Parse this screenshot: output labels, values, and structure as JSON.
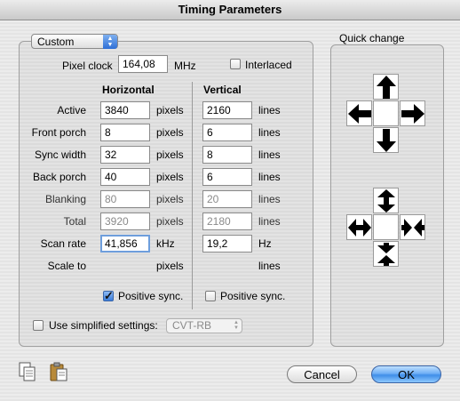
{
  "window": {
    "title": "Timing Parameters"
  },
  "mode_popup": {
    "value": "Custom"
  },
  "pixel_clock": {
    "label": "Pixel clock",
    "value": "164,08",
    "unit": "MHz"
  },
  "interlaced": {
    "label": "Interlaced",
    "checked": false
  },
  "columns": {
    "horizontal": "Horizontal",
    "vertical": "Vertical"
  },
  "rows": [
    {
      "label": "Active",
      "h": "3840",
      "h_unit": "pixels",
      "v": "2160",
      "v_unit": "lines"
    },
    {
      "label": "Front porch",
      "h": "8",
      "h_unit": "pixels",
      "v": "6",
      "v_unit": "lines"
    },
    {
      "label": "Sync width",
      "h": "32",
      "h_unit": "pixels",
      "v": "8",
      "v_unit": "lines"
    },
    {
      "label": "Back porch",
      "h": "40",
      "h_unit": "pixels",
      "v": "6",
      "v_unit": "lines"
    },
    {
      "label": "Blanking",
      "h": "80",
      "h_unit": "pixels",
      "v": "20",
      "v_unit": "lines"
    },
    {
      "label": "Total",
      "h": "3920",
      "h_unit": "pixels",
      "v": "2180",
      "v_unit": "lines"
    },
    {
      "label": "Scan rate",
      "h": "41,856",
      "h_unit": "kHz",
      "v": "19,2",
      "v_unit": "Hz"
    },
    {
      "label": "Scale to",
      "h": "",
      "h_unit": "pixels",
      "v": "",
      "v_unit": "lines"
    }
  ],
  "h_positive_sync": {
    "label": "Positive sync.",
    "checked": true
  },
  "v_positive_sync": {
    "label": "Positive sync.",
    "checked": false
  },
  "simplified": {
    "label": "Use simplified settings:",
    "checked": false,
    "popup_value": "CVT-RB"
  },
  "quick_change": {
    "label": "Quick change"
  },
  "buttons": {
    "cancel": "Cancel",
    "ok": "OK"
  },
  "icons": {
    "copy": "copy-icon",
    "paste": "paste-icon",
    "up": "arrow-up-icon",
    "down": "arrow-down-icon",
    "left": "arrow-left-icon",
    "right": "arrow-right-icon",
    "expand_v": "expand-vertical-icon",
    "shrink_v": "shrink-vertical-icon",
    "expand_h": "expand-horizontal-icon",
    "shrink_h": "shrink-horizontal-icon"
  }
}
